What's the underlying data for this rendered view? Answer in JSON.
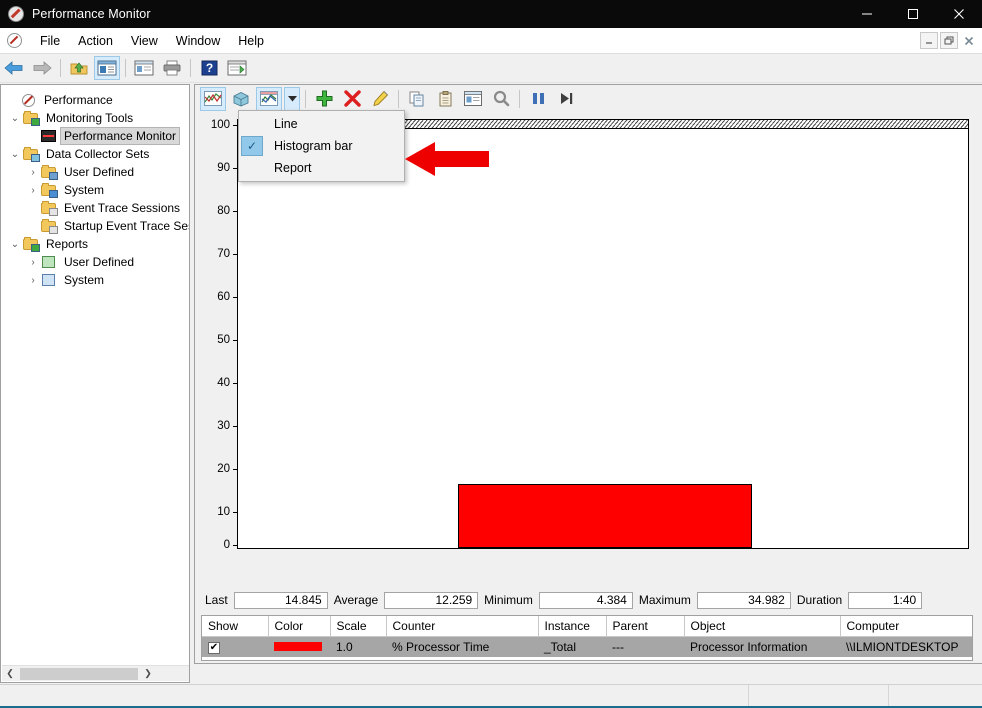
{
  "window": {
    "title": "Performance Monitor",
    "app_icon": "perfmon-icon",
    "controls": {
      "minimize": "minimize-icon",
      "maximize": "maximize-icon",
      "close": "close-icon"
    }
  },
  "menubar": {
    "items": [
      {
        "label": "File"
      },
      {
        "label": "Action"
      },
      {
        "label": "View"
      },
      {
        "label": "Window"
      },
      {
        "label": "Help"
      }
    ],
    "mdi_controls": {
      "minimize": "mdi-minimize-icon",
      "restore": "mdi-restore-icon",
      "close": "mdi-close-icon"
    }
  },
  "main_toolbar": {
    "buttons": [
      {
        "name": "back-button",
        "icon": "back-arrow-icon"
      },
      {
        "name": "forward-button",
        "icon": "forward-arrow-icon"
      },
      {
        "name": "up-folder-button",
        "icon": "up-folder-icon"
      },
      {
        "name": "show-hide-console-tree-button",
        "icon": "console-tree-icon",
        "active": true
      },
      {
        "name": "properties-button",
        "icon": "properties-icon"
      },
      {
        "name": "print-button",
        "icon": "printer-icon"
      },
      {
        "name": "help-button",
        "icon": "help-icon"
      },
      {
        "name": "export-list-button",
        "icon": "export-list-icon"
      }
    ]
  },
  "sidebar": {
    "tree": [
      {
        "label": "Performance",
        "icon": "perfmon-root-icon",
        "indent": 0,
        "twisty": "",
        "selected": false
      },
      {
        "label": "Monitoring Tools",
        "icon": "folder-green-icon",
        "indent": 1,
        "twisty": "expanded",
        "selected": false
      },
      {
        "label": "Performance Monitor",
        "icon": "perfmon-chart-icon",
        "indent": 2,
        "twisty": "",
        "selected": true
      },
      {
        "label": "Data Collector Sets",
        "icon": "folder-cyan-icon",
        "indent": 1,
        "twisty": "expanded",
        "selected": false
      },
      {
        "label": "User Defined",
        "icon": "folder-user-icon",
        "indent": 2,
        "twisty": "collapsed",
        "selected": false
      },
      {
        "label": "System",
        "icon": "folder-blue-icon",
        "indent": 2,
        "twisty": "collapsed",
        "selected": false
      },
      {
        "label": "Event Trace Sessions",
        "icon": "folder-trace-icon",
        "indent": 2,
        "twisty": "",
        "selected": false
      },
      {
        "label": "Startup Event Trace Sess",
        "icon": "folder-trace-icon",
        "indent": 2,
        "twisty": "",
        "selected": false
      },
      {
        "label": "Reports",
        "icon": "folder-green-icon",
        "indent": 1,
        "twisty": "expanded",
        "selected": false
      },
      {
        "label": "User Defined",
        "icon": "report-user-icon",
        "indent": 2,
        "twisty": "collapsed",
        "selected": false
      },
      {
        "label": "System",
        "icon": "report-blue-icon",
        "indent": 2,
        "twisty": "collapsed",
        "selected": false
      }
    ],
    "hscroll": {
      "left_arrow": "chevron-left-icon",
      "right_arrow": "chevron-right-icon"
    }
  },
  "chart_toolbar": {
    "buttons": [
      {
        "name": "view-graph-button",
        "icon": "line-graph-icon",
        "active": true
      },
      {
        "name": "view-current-activity-button",
        "icon": "cube-icon",
        "active": false
      },
      {
        "name": "change-graph-type-button",
        "icon": "graph-type-icon",
        "active": true
      },
      {
        "name": "change-graph-type-dropdown",
        "icon": "chevron-down-icon",
        "active": true
      },
      {
        "name": "add-counter-button",
        "icon": "plus-green-icon"
      },
      {
        "name": "delete-counter-button",
        "icon": "delete-red-x-icon"
      },
      {
        "name": "highlight-button",
        "icon": "highlighter-icon"
      },
      {
        "name": "copy-properties-button",
        "icon": "copy-icon"
      },
      {
        "name": "paste-counter-list-button",
        "icon": "clipboard-icon"
      },
      {
        "name": "properties-button",
        "icon": "properties-window-icon"
      },
      {
        "name": "zoom-button",
        "icon": "magnifier-icon"
      },
      {
        "name": "freeze-display-button",
        "icon": "pause-icon"
      },
      {
        "name": "update-data-button",
        "icon": "step-forward-icon"
      }
    ]
  },
  "graph_type_menu": {
    "visible": true,
    "items": [
      {
        "label": "Line",
        "checked": false
      },
      {
        "label": "Histogram bar",
        "checked": true
      },
      {
        "label": "Report",
        "checked": false
      }
    ],
    "check_glyph": "✓"
  },
  "annotation": {
    "arrow": {
      "name": "red-pointer-arrow",
      "color": "#ee0000",
      "direction": "left"
    }
  },
  "chart_data": {
    "type": "bar",
    "title": "",
    "xlabel": "",
    "ylabel": "",
    "ylim": [
      0,
      100
    ],
    "yticks": [
      100,
      90,
      80,
      70,
      60,
      50,
      40,
      30,
      20,
      10,
      0
    ],
    "grid": false,
    "legend_position": "bottom-table",
    "categories": [
      "% Processor Time"
    ],
    "values": [
      14.845
    ],
    "series": [
      {
        "name": "% Processor Time",
        "values": [
          14.845
        ],
        "color": "#ff0000"
      }
    ],
    "annotations": [
      "hatched band at top of plot area (100% marker)"
    ]
  },
  "stats": {
    "items": [
      {
        "label": "Last",
        "value": "14.845",
        "width": 94
      },
      {
        "label": "Average",
        "value": "12.259",
        "width": 94
      },
      {
        "label": "Minimum",
        "value": "4.384",
        "width": 94
      },
      {
        "label": "Maximum",
        "value": "34.982",
        "width": 94
      },
      {
        "label": "Duration",
        "value": "1:40",
        "width": 74
      }
    ]
  },
  "legend": {
    "columns": [
      "Show",
      "Color",
      "Scale",
      "Counter",
      "Instance",
      "Parent",
      "Object",
      "Computer"
    ],
    "rows": [
      {
        "show": true,
        "color": "#ff0000",
        "scale": "1.0",
        "counter": "% Processor Time",
        "instance": "_Total",
        "parent": "---",
        "object": "Processor Information",
        "computer": "\\\\ILMIONTDESKTOP"
      }
    ],
    "check_glyph": "✔"
  },
  "statusbar": {
    "main": "",
    "pane1": "",
    "pane2": ""
  },
  "colors": {
    "titlebar_bg": "#0a0a0a",
    "accent_red": "#ff0000",
    "selection_blue": "#92c8ea",
    "row_gray": "#a6a6a6",
    "bottom_accent": "#1a6d8f"
  }
}
